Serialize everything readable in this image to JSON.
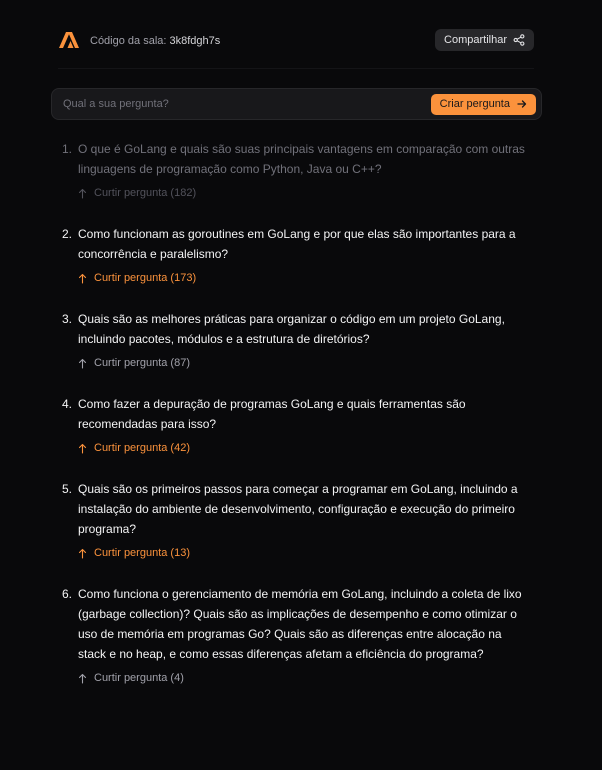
{
  "header": {
    "room_label": "Código da sala:",
    "room_code": "3k8fdgh7s",
    "share_label": "Compartilhar",
    "icons": {
      "logo": "logo-icon",
      "share": "share-icon"
    }
  },
  "form": {
    "placeholder": "Qual a sua pergunta?",
    "submit_label": "Criar pergunta",
    "submit_icon": "arrow-right-icon"
  },
  "colors": {
    "background": "#09090b",
    "accent": "#fb923c",
    "answered_text": "#71717a"
  },
  "questions": [
    {
      "number": "1.",
      "text": "O que é GoLang e quais são suas principais vantagens em comparação com outras linguagens de programação como Python, Java ou C++?",
      "like_label": "Curtir pergunta (182)",
      "liked": false,
      "answered": true
    },
    {
      "number": "2.",
      "text": "Como funcionam as goroutines em GoLang e por que elas são importantes para a concorrência e paralelismo?",
      "like_label": "Curtir pergunta (173)",
      "liked": true,
      "answered": false
    },
    {
      "number": "3.",
      "text": "Quais são as melhores práticas para organizar o código em um projeto GoLang, incluindo pacotes, módulos e a estrutura de diretórios?",
      "like_label": "Curtir pergunta (87)",
      "liked": false,
      "answered": false
    },
    {
      "number": "4.",
      "text": "Como fazer a depuração de programas GoLang e quais ferramentas são recomendadas para isso?",
      "like_label": "Curtir pergunta (42)",
      "liked": true,
      "answered": false
    },
    {
      "number": "5.",
      "text": "Quais são os primeiros passos para começar a programar em GoLang, incluindo a instalação do ambiente de desenvolvimento, configuração e execução do primeiro programa?",
      "like_label": "Curtir pergunta (13)",
      "liked": true,
      "answered": false
    },
    {
      "number": "6.",
      "text": "Como funciona o gerenciamento de memória em GoLang, incluindo a coleta de lixo (garbage collection)? Quais são as implicações de desempenho e como otimizar o uso de memória em programas Go? Quais são as diferenças entre alocação na stack e no heap, e como essas diferenças afetam a eficiência do programa?",
      "like_label": "Curtir pergunta (4)",
      "liked": false,
      "answered": false
    }
  ]
}
